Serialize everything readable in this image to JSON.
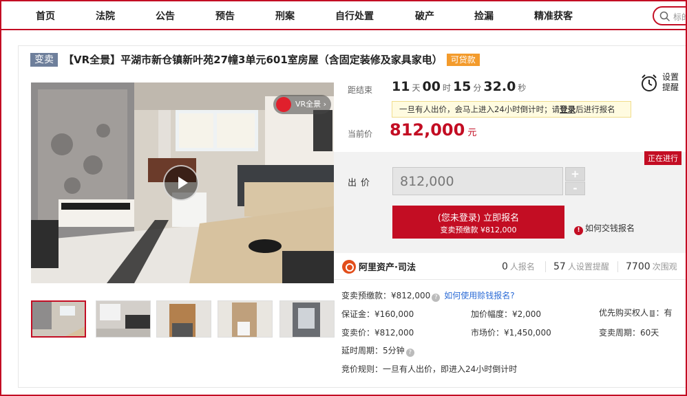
{
  "nav": {
    "items": [
      "首页",
      "法院",
      "公告",
      "预告",
      "刑案",
      "自行处置",
      "破产",
      "捡漏",
      "精准获客"
    ],
    "search_placeholder": "标的"
  },
  "listing": {
    "badge": "变卖",
    "title": "【VR全景】平湖市新仓镇新叶苑27幢3单元601室房屋（含固定装修及家具家电）",
    "loan_badge": "可贷款",
    "vr_label": "VR全景",
    "vr_chevron": "›"
  },
  "countdown": {
    "label": "距结束",
    "days": "11",
    "days_unit": "天",
    "hours": "00",
    "hours_unit": "时",
    "minutes": "15",
    "minutes_unit": "分",
    "seconds": "32.0",
    "seconds_unit": "秒"
  },
  "remind": {
    "label": "设置提醒"
  },
  "notice": {
    "text_before": "一旦有人出价，会马上进入24小时倒计时；请",
    "login": "登录",
    "text_after": "后进行报名"
  },
  "current_price": {
    "label": "当前价",
    "value": "812,000",
    "unit": "元"
  },
  "bid": {
    "status": "正在进行",
    "label": "出价",
    "value": "812,000",
    "plus": "+",
    "minus": "-",
    "button_line1": "(您未登录) 立即报名",
    "button_line2": "变卖预缴款 ¥812,000",
    "howto": "如何交钱报名"
  },
  "stats": {
    "brand": "阿里资产·司法",
    "signups": "0",
    "signups_unit": "人报名",
    "reminders": "57",
    "reminders_unit": "人设置提醒",
    "views": "7700",
    "views_unit": "次围观"
  },
  "info": {
    "deposit_pre": "变卖预缴款：¥812,000",
    "deposit_link": "如何使用赊钱报名?",
    "guarantee": "保证金：¥160,000",
    "increment": "加价幅度：¥2,000",
    "priority": "优先购买权人",
    "priority_tag": "i",
    "priority_value": "：有",
    "sale_price": "变卖价：¥812,000",
    "market_price": "市场价：¥1,450,000",
    "sale_period": "变卖周期：60天",
    "delay": "延时周期：5分钟",
    "rule": "竞价规则：一旦有人出价，即进入24小时倒计时"
  },
  "colors": {
    "accent": "#c30d23",
    "badge": "#6e7f9b",
    "loan": "#f39b2c",
    "link": "#2b6bd6"
  },
  "icons": [
    "search-icon",
    "alarm-clock-icon",
    "play-icon",
    "vr-icon",
    "info-icon",
    "question-icon",
    "brand-logo-icon"
  ]
}
